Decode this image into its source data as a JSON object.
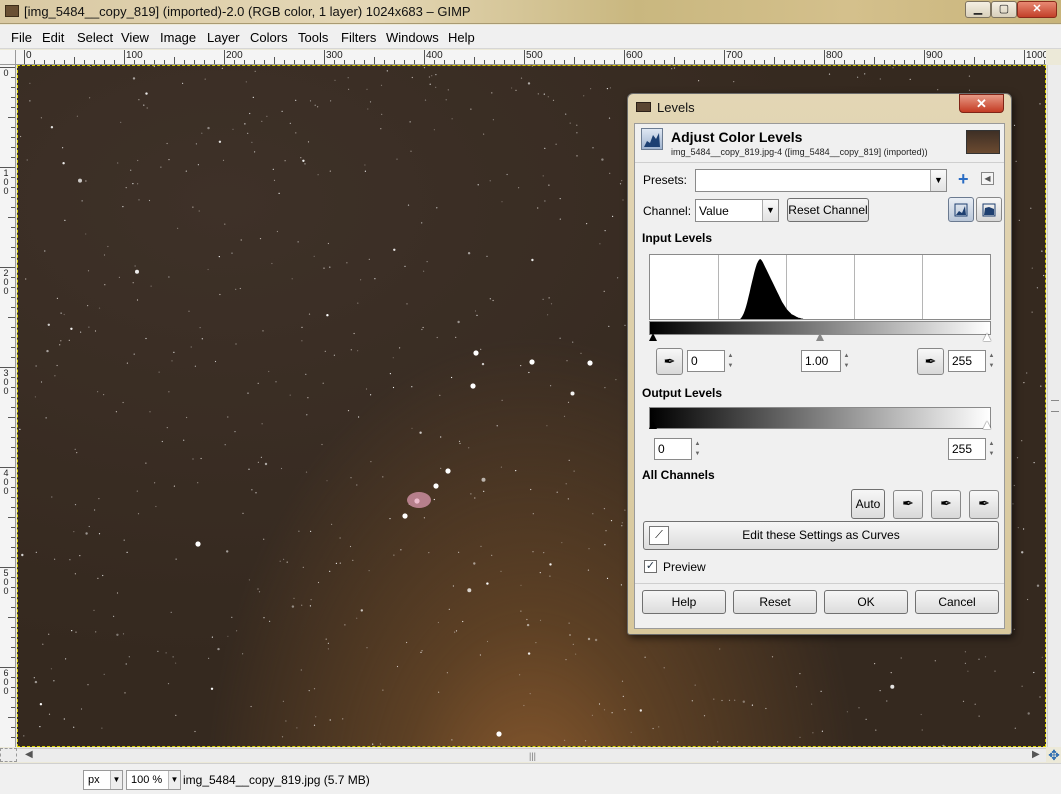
{
  "window": {
    "title": "[img_5484__copy_819] (imported)-2.0 (RGB color, 1 layer) 1024x683 – GIMP",
    "min_label": "▁",
    "max_label": "▢",
    "close_label": "✕"
  },
  "menubar": {
    "items": [
      "File",
      "Edit",
      "Select",
      "View",
      "Image",
      "Layer",
      "Colors",
      "Tools",
      "Filters",
      "Windows",
      "Help"
    ]
  },
  "rulers": {
    "h_labels": [
      "0",
      "100",
      "200",
      "300",
      "400",
      "500",
      "600",
      "700",
      "800",
      "900",
      "1000"
    ],
    "v_labels": [
      "0",
      "100",
      "200",
      "300",
      "400",
      "500",
      "600"
    ]
  },
  "statusbar": {
    "unit": "px",
    "zoom": "100 %",
    "file_info": "img_5484__copy_819.jpg (5.7 MB)"
  },
  "levels": {
    "title": "Levels",
    "close_label": "✕",
    "header_title": "Adjust Color Levels",
    "header_subtitle": "img_5484__copy_819.jpg-4 ([img_5484__copy_819] (imported))",
    "presets_label": "Presets:",
    "presets_value": "",
    "channel_label": "Channel:",
    "channel_value": "Value",
    "reset_channel": "Reset Channel",
    "input_levels_label": "Input Levels",
    "input_low": "0",
    "input_gamma": "1.00",
    "input_high": "255",
    "output_levels_label": "Output Levels",
    "output_low": "0",
    "output_high": "255",
    "all_channels_label": "All Channels",
    "auto_label": "Auto",
    "edit_curves_label": "Edit these Settings as Curves",
    "preview_label": "Preview",
    "preview_checked": true,
    "help_label": "Help",
    "reset_label": "Reset",
    "ok_label": "OK",
    "cancel_label": "Cancel"
  },
  "histogram": {
    "values": [
      0,
      0,
      0,
      0,
      0,
      0,
      0,
      0,
      0,
      0,
      0,
      0,
      0,
      0,
      0,
      0,
      0,
      0,
      0,
      0,
      0,
      0,
      0,
      0,
      0,
      0,
      0,
      0,
      0,
      0,
      0,
      0,
      0,
      0,
      0,
      0,
      0,
      0,
      0,
      0,
      0,
      0,
      0,
      0,
      0,
      0,
      0,
      0,
      0,
      0,
      0,
      0,
      0,
      0,
      0,
      0,
      0,
      0,
      0,
      0,
      0,
      0,
      0,
      0,
      0,
      0,
      0,
      0,
      0,
      0,
      0,
      0,
      1,
      1,
      2,
      3,
      5,
      8,
      12,
      17,
      23,
      30,
      38,
      46,
      55,
      63,
      71,
      79,
      86,
      92,
      96,
      99,
      100,
      98,
      95,
      91,
      87,
      83,
      79,
      75,
      71,
      67,
      63,
      59,
      55,
      51,
      47,
      43,
      39,
      35,
      31,
      28,
      25,
      22,
      19,
      17,
      15,
      13,
      11,
      10,
      9,
      8,
      7,
      6,
      5,
      5,
      4,
      4,
      3,
      3,
      3,
      2,
      2,
      2,
      2,
      1,
      1,
      1,
      1,
      1,
      1,
      1,
      1,
      1,
      1,
      1,
      1,
      1,
      0,
      0,
      0,
      0,
      0,
      0,
      0,
      0,
      0,
      0,
      0,
      0,
      0,
      0,
      0,
      0,
      0,
      0,
      0,
      0,
      0,
      0,
      0,
      0,
      0,
      0,
      0,
      0,
      0,
      0,
      0,
      0,
      0,
      0,
      0,
      0,
      0,
      0,
      0,
      0,
      0,
      0,
      0,
      0,
      0,
      0,
      0,
      0,
      0,
      0,
      0,
      0,
      0,
      0,
      0,
      0,
      0,
      0,
      0,
      0,
      0,
      0,
      0,
      0,
      0,
      0,
      0,
      0,
      0,
      0,
      0,
      0,
      0,
      0,
      0,
      0,
      0,
      0,
      0,
      0,
      0,
      0,
      0,
      0,
      0,
      0,
      0,
      0,
      0,
      0,
      0,
      0,
      0,
      0,
      0,
      0,
      0,
      0,
      0,
      0,
      0,
      0,
      0,
      0,
      0,
      0,
      0,
      0,
      0,
      0,
      0,
      0,
      0,
      0,
      0,
      0,
      0,
      0,
      0,
      0,
      0,
      0,
      0,
      0,
      0,
      0,
      0,
      0,
      0,
      0,
      0,
      0,
      0,
      0,
      0,
      0,
      0,
      0
    ],
    "gamma_marker_fraction": 0.5
  }
}
